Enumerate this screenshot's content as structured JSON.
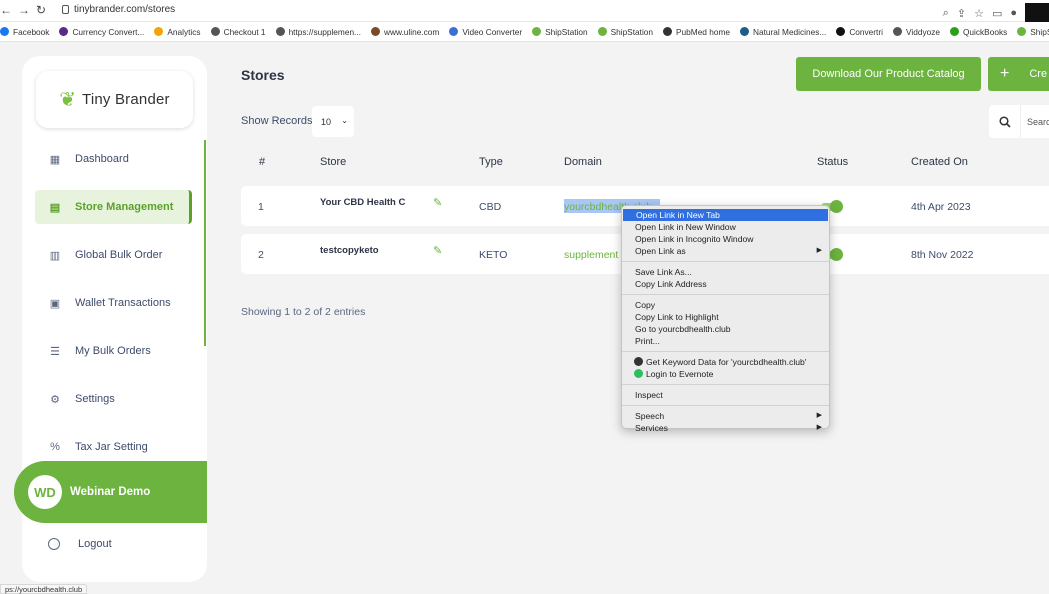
{
  "browser": {
    "url": "tinybrander.com/stores",
    "bookmarks": [
      {
        "label": "Facebook",
        "color": "#1877f2"
      },
      {
        "label": "Currency Convert...",
        "color": "#5b2a86"
      },
      {
        "label": "Analytics",
        "color": "#f4a300"
      },
      {
        "label": "Checkout 1",
        "color": "#555555"
      },
      {
        "label": "https://supplemen...",
        "color": "#555555"
      },
      {
        "label": "www.uline.com",
        "color": "#7a4a2a"
      },
      {
        "label": "Video Converter",
        "color": "#3a6fd8"
      },
      {
        "label": "ShipStation",
        "color": "#6db33f"
      },
      {
        "label": "ShipStation",
        "color": "#6db33f"
      },
      {
        "label": "PubMed home",
        "color": "#333333"
      },
      {
        "label": "Natural Medicines...",
        "color": "#1b5e8c"
      },
      {
        "label": "Convertri",
        "color": "#111111"
      },
      {
        "label": "Viddyoze",
        "color": "#555555"
      },
      {
        "label": "QuickBooks",
        "color": "#2ca01c"
      },
      {
        "label": "ShipS",
        "color": "#6db33f"
      }
    ],
    "status_url": "ps://yourcbdhealth.club"
  },
  "brand": {
    "name": "Tiny Brander",
    "accent": "#6db33f"
  },
  "sidebar": {
    "items": [
      {
        "label": "Dashboard",
        "icon": "grid-icon",
        "glyph": "▦"
      },
      {
        "label": "Store Management",
        "icon": "store-icon",
        "glyph": "▤"
      },
      {
        "label": "Global Bulk Order",
        "icon": "boxes-icon",
        "glyph": "▥"
      },
      {
        "label": "Wallet Transactions",
        "icon": "wallet-icon",
        "glyph": "▣"
      },
      {
        "label": "My Bulk Orders",
        "icon": "list-icon",
        "glyph": "☰"
      },
      {
        "label": "Settings",
        "icon": "gear-icon",
        "glyph": "⚙"
      },
      {
        "label": "Tax Jar Setting",
        "icon": "tax-icon",
        "glyph": "%"
      }
    ],
    "user": {
      "initials": "WD",
      "name": "Webinar Demo"
    },
    "logout": "Logout"
  },
  "main": {
    "title": "Stores",
    "download_button": "Download Our Product Catalog",
    "create_button": "Cre",
    "show_records_label": "Show Records",
    "records_value": "10",
    "search_placeholder": "Searc",
    "columns": [
      "#",
      "Store",
      "Type",
      "Domain",
      "Status",
      "Created On"
    ],
    "rows": [
      {
        "num": "1",
        "store": "Your CBD Health C",
        "type": "CBD",
        "domain": "yourcbdhealth.club",
        "created": "4th Apr 2023"
      },
      {
        "num": "2",
        "store": "testcopyketo",
        "type": "KETO",
        "domain": "supplement",
        "created": "8th Nov 2022"
      }
    ],
    "showing": "Showing 1 to 2 of 2 entries"
  },
  "context_menu": {
    "groups": [
      [
        {
          "label": "Open Link in New Tab",
          "selected": true
        },
        {
          "label": "Open Link in New Window"
        },
        {
          "label": "Open Link in Incognito Window"
        },
        {
          "label": "Open Link as",
          "submenu": true
        }
      ],
      [
        {
          "label": "Save Link As..."
        },
        {
          "label": "Copy Link Address"
        }
      ],
      [
        {
          "label": "Copy"
        },
        {
          "label": "Copy Link to Highlight"
        },
        {
          "label": "Go to yourcbdhealth.club"
        },
        {
          "label": "Print..."
        }
      ],
      [
        {
          "label": "Get Keyword Data for 'yourcbdhealth.club'",
          "icon": "keyword-icon",
          "icon_color": "#333333"
        },
        {
          "label": "Login to Evernote",
          "icon": "evernote-icon",
          "icon_color": "#2dbe60"
        }
      ],
      [
        {
          "label": "Inspect"
        }
      ],
      [
        {
          "label": "Speech",
          "submenu": true
        },
        {
          "label": "Services",
          "submenu": true
        }
      ]
    ]
  }
}
